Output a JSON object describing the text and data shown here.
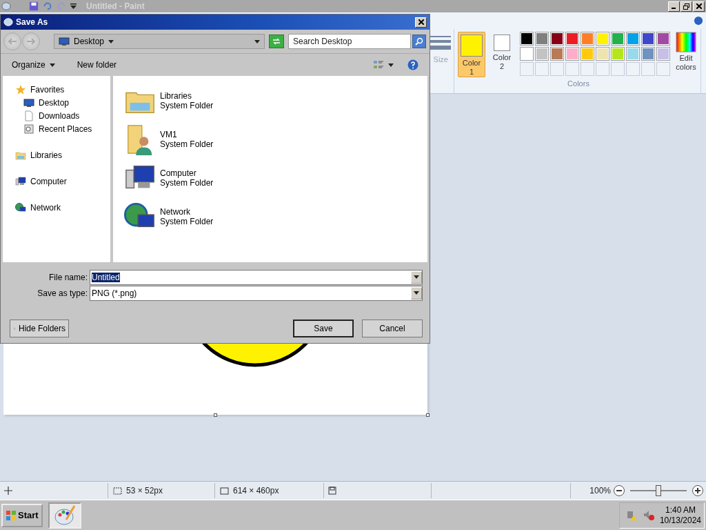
{
  "paint_window": {
    "title": "Untitled - Paint",
    "active": false
  },
  "ribbon": {
    "size_label": "Size",
    "color_slots": [
      {
        "label": "Color 1",
        "color": "#fff200",
        "selected": true
      },
      {
        "label": "Color 2",
        "color": "#ffffff",
        "selected": false
      }
    ],
    "swatches": [
      {
        "kind": "color",
        "color": "#000000"
      },
      {
        "kind": "color",
        "color": "#7f7f7f"
      },
      {
        "kind": "color",
        "color": "#880015"
      },
      {
        "kind": "color",
        "color": "#ed1c24"
      },
      {
        "kind": "color",
        "color": "#ff7f27"
      },
      {
        "kind": "color",
        "color": "#fff200"
      },
      {
        "kind": "color",
        "color": "#22b14c"
      },
      {
        "kind": "color",
        "color": "#00a2e8"
      },
      {
        "kind": "color",
        "color": "#3f48cc"
      },
      {
        "kind": "color",
        "color": "#a349a4"
      },
      {
        "kind": "color",
        "color": "#ffffff"
      },
      {
        "kind": "color",
        "color": "#c3c3c3"
      },
      {
        "kind": "color",
        "color": "#b97a57"
      },
      {
        "kind": "color",
        "color": "#ffaec9"
      },
      {
        "kind": "color",
        "color": "#ffc90e"
      },
      {
        "kind": "color",
        "color": "#efe4b0"
      },
      {
        "kind": "color",
        "color": "#b5e61d"
      },
      {
        "kind": "color",
        "color": "#99d9ea"
      },
      {
        "kind": "color",
        "color": "#7092be"
      },
      {
        "kind": "color",
        "color": "#c8bfe7"
      },
      {
        "kind": "empty"
      },
      {
        "kind": "empty"
      },
      {
        "kind": "empty"
      },
      {
        "kind": "empty"
      },
      {
        "kind": "empty"
      },
      {
        "kind": "empty"
      },
      {
        "kind": "empty"
      },
      {
        "kind": "empty"
      },
      {
        "kind": "empty"
      },
      {
        "kind": "empty"
      }
    ],
    "edit_colors": "Edit colors",
    "group_label": "Colors"
  },
  "dialog": {
    "title": "Save As",
    "nav": {
      "back": {
        "disabled": true
      },
      "forward": {
        "disabled": true
      },
      "location": "Desktop",
      "search_placeholder": "Search Desktop"
    },
    "toolbar": {
      "organize": "Organize",
      "new_folder": "New folder"
    },
    "tree": [
      {
        "label": "Favorites",
        "kind": "favorites",
        "children": [
          {
            "label": "Desktop",
            "kind": "desktop"
          },
          {
            "label": "Downloads",
            "kind": "downloads"
          },
          {
            "label": "Recent Places",
            "kind": "recent"
          }
        ]
      },
      {
        "label": "Libraries",
        "kind": "libraries"
      },
      {
        "label": "Computer",
        "kind": "computer"
      },
      {
        "label": "Network",
        "kind": "network"
      }
    ],
    "items": [
      {
        "name": "Libraries",
        "type": "System Folder",
        "kind": "libraries"
      },
      {
        "name": "VM1",
        "type": "System Folder",
        "kind": "user"
      },
      {
        "name": "Computer",
        "type": "System Folder",
        "kind": "computer"
      },
      {
        "name": "Network",
        "type": "System Folder",
        "kind": "network"
      }
    ],
    "file_name": {
      "label": "File name:",
      "value": "Untitled",
      "text_selected": true
    },
    "save_type": {
      "label": "Save as type:",
      "value": "PNG (*.png)"
    },
    "hide_folders": "Hide Folders",
    "save": "Save",
    "cancel": "Cancel"
  },
  "status_bar": {
    "selection_size": "53 × 52px",
    "canvas_size": "614 × 460px",
    "zoom": "100%",
    "zoom_slider": {
      "level": 0.5
    }
  },
  "taskbar": {
    "start": "Start",
    "tasks": [
      {
        "kind": "paint",
        "selected": true
      }
    ],
    "time": "1:40 AM",
    "date": "10/13/2024"
  }
}
